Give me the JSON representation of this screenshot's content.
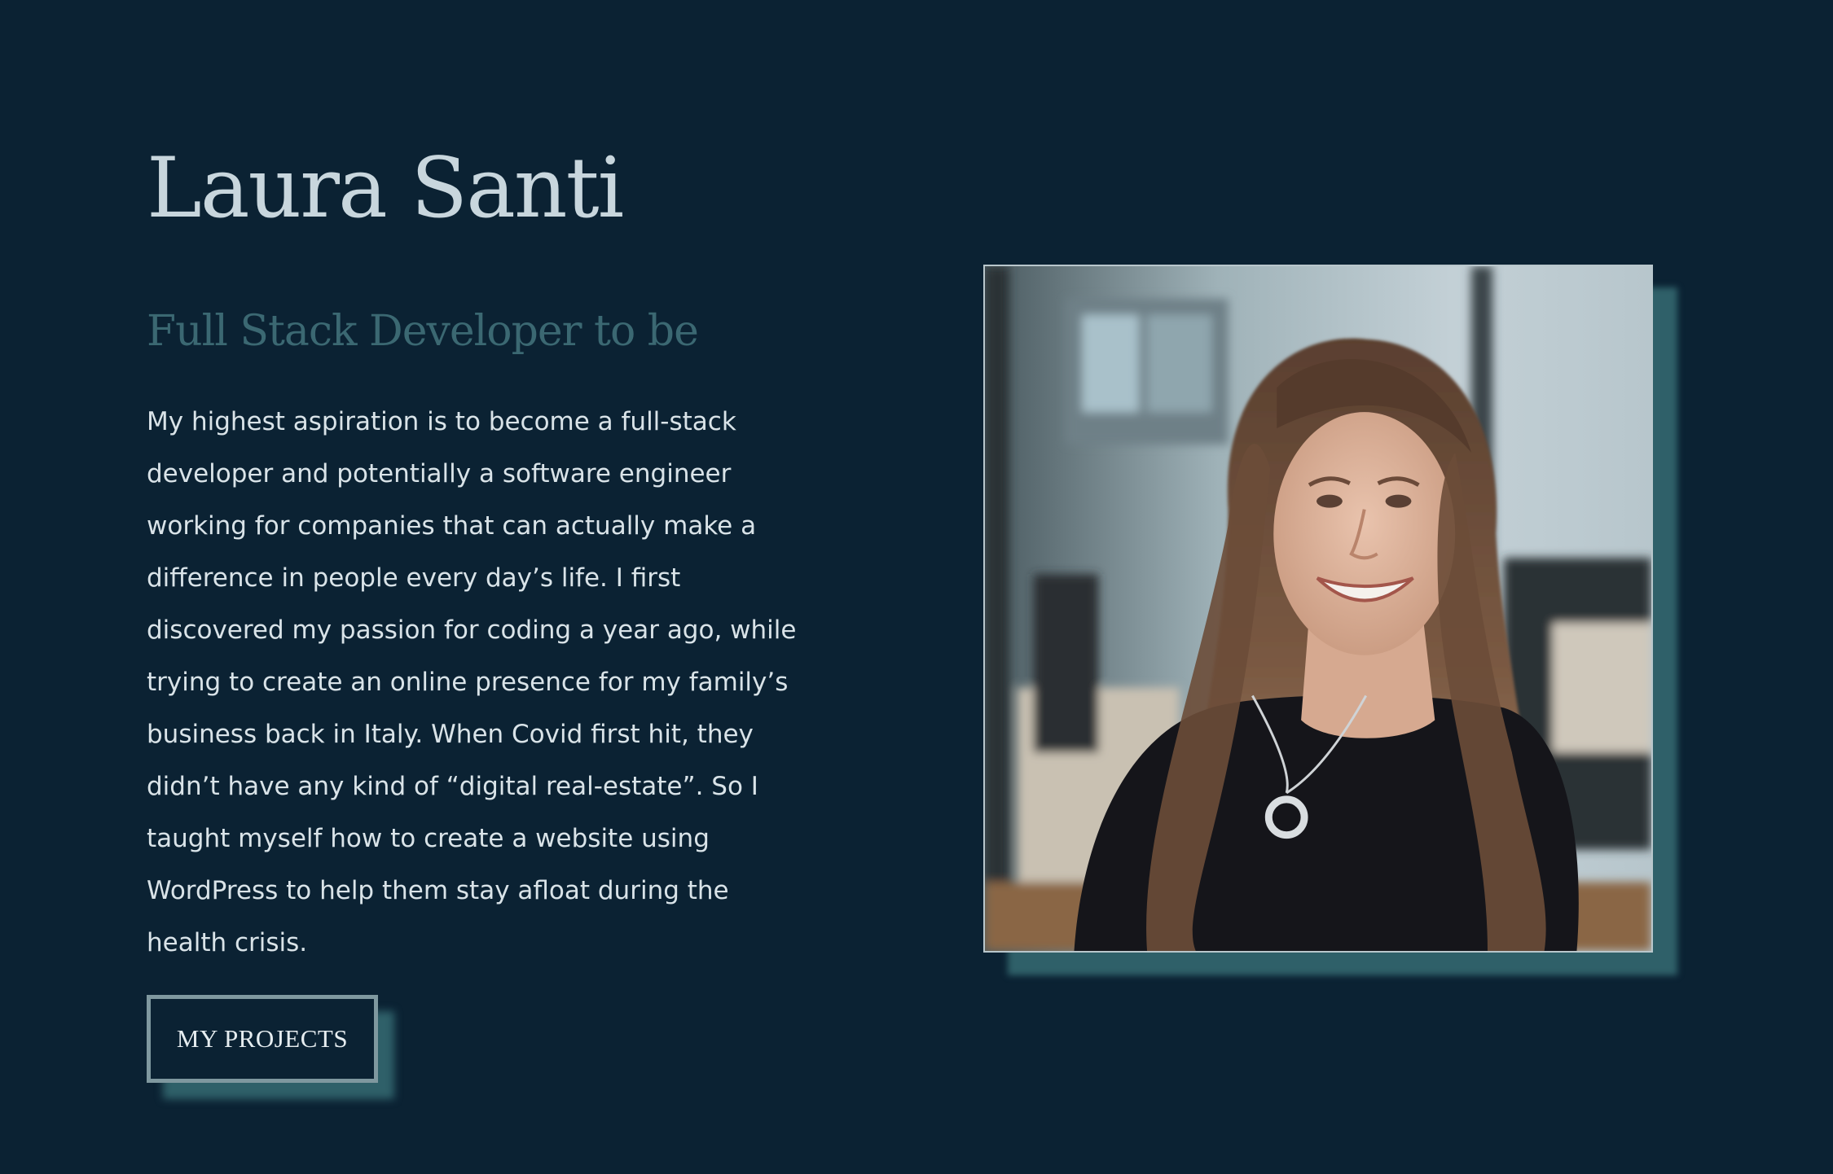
{
  "hero": {
    "name": "Laura Santi",
    "subtitle": "Full Stack Developer to be",
    "bio": "My highest aspiration is to become a full-stack developer and potentially a software engineer working for companies that can actually make a difference in people every day’s life. I first discovered my passion for coding a year ago, while trying to create an online presence for my family’s business back in Italy. When Covid first hit, they didn’t have any kind of “digital real-estate”. So I taught myself how to create a website using WordPress to help them stay afloat during the health crisis.",
    "cta_label": "MY PROJECTS"
  },
  "colors": {
    "background": "#0b2233",
    "name": "#c8d6dd",
    "subtitle": "#3b6872",
    "accent_shadow": "#2f6069",
    "body_text": "#d9e3e8"
  }
}
